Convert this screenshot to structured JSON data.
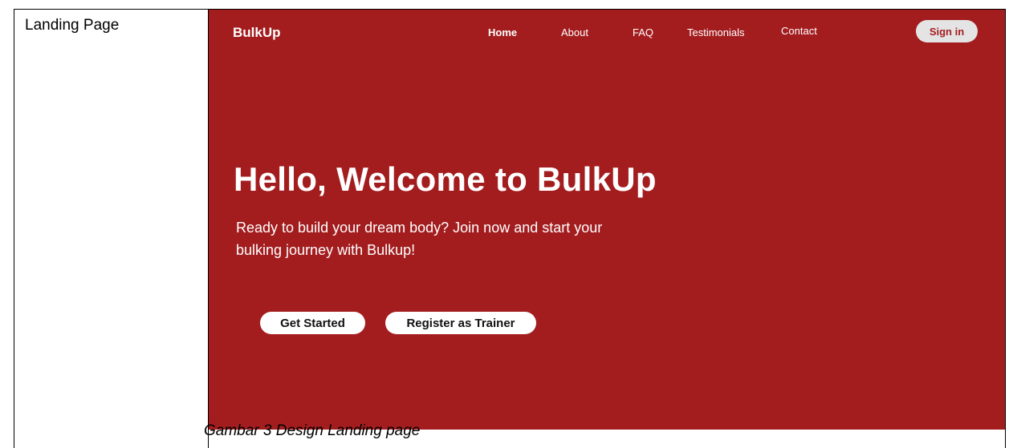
{
  "document": {
    "row_label": "Landing Page",
    "caption": "Gambar 3 Design Landing page"
  },
  "mockup": {
    "background_color": "#a31d1f",
    "brand": "BulkUp",
    "nav": {
      "items": [
        {
          "label": "Home",
          "active": true
        },
        {
          "label": "About",
          "active": false
        },
        {
          "label": "FAQ",
          "active": false
        },
        {
          "label": "Testimonials",
          "active": false
        },
        {
          "label": "Contact",
          "active": false
        }
      ],
      "sign_in_label": "Sign in"
    },
    "hero": {
      "title": "Hello, Welcome to BulkUp",
      "subtitle": "Ready to build your dream body? Join now and start your bulking journey with Bulkup!",
      "primary_button": "Get Started",
      "secondary_button": "Register as Trainer"
    }
  }
}
